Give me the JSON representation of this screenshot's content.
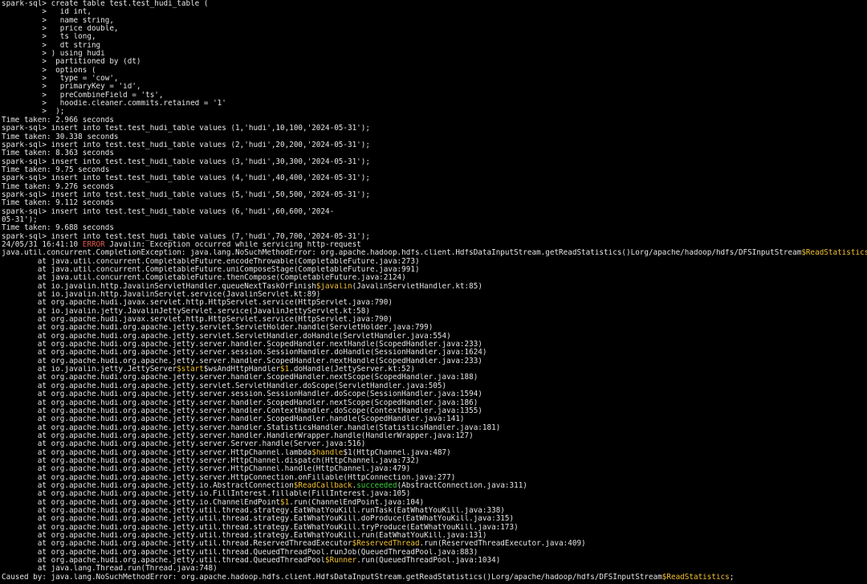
{
  "colors": {
    "background": "#000000",
    "text": "#e6e6e6",
    "highlight_yellow": "#f2c230",
    "highlight_red": "#e05a4e",
    "highlight_green": "#3fcf3f"
  },
  "terminal": {
    "lines": [
      [
        {
          "t": "spark-sql> create table test.test_hudi_table ("
        }
      ],
      [
        {
          "t": "         >   id int,"
        }
      ],
      [
        {
          "t": "         >   name string,"
        }
      ],
      [
        {
          "t": "         >   price double,"
        }
      ],
      [
        {
          "t": "         >   ts long,"
        }
      ],
      [
        {
          "t": "         >   dt string"
        }
      ],
      [
        {
          "t": "         > ) using hudi"
        }
      ],
      [
        {
          "t": "         >  partitioned by (dt)"
        }
      ],
      [
        {
          "t": "         >  options ("
        }
      ],
      [
        {
          "t": "         >   type = 'cow',"
        }
      ],
      [
        {
          "t": "         >   primaryKey = 'id',"
        }
      ],
      [
        {
          "t": "         >   preCombineField = 'ts',"
        }
      ],
      [
        {
          "t": "         >   hoodie.cleaner.commits.retained = '1'"
        }
      ],
      [
        {
          "t": "         >  );"
        }
      ],
      [
        {
          "t": "Time taken: 2.966 seconds"
        }
      ],
      [
        {
          "t": "spark-sql> insert into test.test_hudi_table values (1,'hudi',10,100,'2024-05-31');"
        }
      ],
      [
        {
          "t": "Time taken: 30.338 seconds"
        }
      ],
      [
        {
          "t": "spark-sql> insert into test.test_hudi_table values (2,'hudi',20,200,'2024-05-31');"
        }
      ],
      [
        {
          "t": "Time taken: 8.363 seconds"
        }
      ],
      [
        {
          "t": "spark-sql> insert into test.test_hudi_table values (3,'hudi',30,300,'2024-05-31');"
        }
      ],
      [
        {
          "t": "Time taken: 9.75 seconds"
        }
      ],
      [
        {
          "t": "spark-sql> insert into test.test_hudi_table values (4,'hudi',40,400,'2024-05-31');"
        }
      ],
      [
        {
          "t": "Time taken: 9.276 seconds"
        }
      ],
      [
        {
          "t": "spark-sql> insert into test.test_hudi_table values (5,'hudi',50,500,'2024-05-31');"
        }
      ],
      [
        {
          "t": "Time taken: 9.112 seconds"
        }
      ],
      [
        {
          "t": "spark-sql> insert into test.test_hudi_table values (6,'hudi',60,600,'2024-"
        }
      ],
      [
        {
          "t": "05-31');"
        }
      ],
      [
        {
          "t": "Time taken: 9.688 seconds"
        }
      ],
      [
        {
          "t": "spark-sql> insert into test.test_hudi_table values (7,'hudi',70,700,'2024-05-31');"
        }
      ],
      [
        {
          "t": "24/05/31 16:41:10 "
        },
        {
          "t": "ERROR",
          "c": "red"
        },
        {
          "t": " Javalin: Exception occurred while servicing http-request"
        }
      ],
      [
        {
          "t": "java.util.concurrent.CompletionException: java.lang.NoSuchMethodError: org.apache.hadoop.hdfs.client.HdfsDataInputStream.getReadStatistics()Lorg/apache/hadoop/hdfs/DFSInputStream"
        },
        {
          "t": "$ReadStatistics",
          "c": "yellow"
        },
        {
          "t": ";"
        }
      ],
      [
        {
          "t": "        at java.util.concurrent.CompletableFuture.encodeThrowable(CompletableFuture.java:273)"
        }
      ],
      [
        {
          "t": "        at java.util.concurrent.CompletableFuture.uniComposeStage(CompletableFuture.java:991)"
        }
      ],
      [
        {
          "t": "        at java.util.concurrent.CompletableFuture.thenCompose(CompletableFuture.java:2124)"
        }
      ],
      [
        {
          "t": "        at io.javalin.http.JavalinServletHandler.queueNextTaskOrFinish"
        },
        {
          "t": "$javalin",
          "c": "yellow"
        },
        {
          "t": "(JavalinServletHandler.kt:85)"
        }
      ],
      [
        {
          "t": "        at io.javalin.http.JavalinServlet.service(JavalinServlet.kt:89)"
        }
      ],
      [
        {
          "t": "        at org.apache.hudi.javax.servlet.http.HttpServlet.service(HttpServlet.java:790)"
        }
      ],
      [
        {
          "t": "        at io.javalin.jetty.JavalinJettyServlet.service(JavalinJettyServlet.kt:58)"
        }
      ],
      [
        {
          "t": "        at org.apache.hudi.javax.servlet.http.HttpServlet.service(HttpServlet.java:790)"
        }
      ],
      [
        {
          "t": "        at org.apache.hudi.org.apache.jetty.servlet.ServletHolder.handle(ServletHolder.java:799)"
        }
      ],
      [
        {
          "t": "        at org.apache.hudi.org.apache.jetty.servlet.ServletHandler.doHandle(ServletHandler.java:554)"
        }
      ],
      [
        {
          "t": "        at org.apache.hudi.org.apache.jetty.server.handler.ScopedHandler.nextHandle(ScopedHandler.java:233)"
        }
      ],
      [
        {
          "t": "        at org.apache.hudi.org.apache.jetty.server.session.SessionHandler.doHandle(SessionHandler.java:1624)"
        }
      ],
      [
        {
          "t": "        at org.apache.hudi.org.apache.jetty.server.handler.ScopedHandler.nextHandle(ScopedHandler.java:233)"
        }
      ],
      [
        {
          "t": "        at io.javalin.jetty.JettyServer"
        },
        {
          "t": "$start",
          "c": "yellow"
        },
        {
          "t": "$wsAndHttpHandler"
        },
        {
          "t": "$1",
          "c": "yellow"
        },
        {
          "t": ".doHandle(JettyServer.kt:52)"
        }
      ],
      [
        {
          "t": "        at org.apache.hudi.org.apache.jetty.server.handler.ScopedHandler.nextScope(ScopedHandler.java:188)"
        }
      ],
      [
        {
          "t": "        at org.apache.hudi.org.apache.jetty.servlet.ServletHandler.doScope(ServletHandler.java:505)"
        }
      ],
      [
        {
          "t": "        at org.apache.hudi.org.apache.jetty.server.session.SessionHandler.doScope(SessionHandler.java:1594)"
        }
      ],
      [
        {
          "t": "        at org.apache.hudi.org.apache.jetty.server.handler.ScopedHandler.nextScope(ScopedHandler.java:186)"
        }
      ],
      [
        {
          "t": "        at org.apache.hudi.org.apache.jetty.server.handler.ContextHandler.doScope(ContextHandler.java:1355)"
        }
      ],
      [
        {
          "t": "        at org.apache.hudi.org.apache.jetty.server.handler.ScopedHandler.handle(ScopedHandler.java:141)"
        }
      ],
      [
        {
          "t": "        at org.apache.hudi.org.apache.jetty.server.handler.StatisticsHandler.handle(StatisticsHandler.java:181)"
        }
      ],
      [
        {
          "t": "        at org.apache.hudi.org.apache.jetty.server.handler.HandlerWrapper.handle(HandlerWrapper.java:127)"
        }
      ],
      [
        {
          "t": "        at org.apache.hudi.org.apache.jetty.server.Server.handle(Server.java:516)"
        }
      ],
      [
        {
          "t": "        at org.apache.hudi.org.apache.jetty.server.HttpChannel.lambda"
        },
        {
          "t": "$handle",
          "c": "yellow"
        },
        {
          "t": "$1(HttpChannel.java:487)"
        }
      ],
      [
        {
          "t": "        at org.apache.hudi.org.apache.jetty.server.HttpChannel.dispatch(HttpChannel.java:732)"
        }
      ],
      [
        {
          "t": "        at org.apache.hudi.org.apache.jetty.server.HttpChannel.handle(HttpChannel.java:479)"
        }
      ],
      [
        {
          "t": "        at org.apache.hudi.org.apache.jetty.server.HttpConnection.onFillable(HttpConnection.java:277)"
        }
      ],
      [
        {
          "t": "        at org.apache.hudi.org.apache.jetty.io.AbstractConnection"
        },
        {
          "t": "$ReadCallback",
          "c": "yellow"
        },
        {
          "t": "."
        },
        {
          "t": "succeeded",
          "c": "green"
        },
        {
          "t": "(AbstractConnection.java:311)"
        }
      ],
      [
        {
          "t": "        at org.apache.hudi.org.apache.jetty.io.FillInterest.fillable(FillInterest.java:105)"
        }
      ],
      [
        {
          "t": "        at org.apache.hudi.org.apache.jetty.io.ChannelEndPoint"
        },
        {
          "t": "$1",
          "c": "yellow"
        },
        {
          "t": ".run(ChannelEndPoint.java:104)"
        }
      ],
      [
        {
          "t": "        at org.apache.hudi.org.apache.jetty.util.thread.strategy.EatWhatYouKill.runTask(EatWhatYouKill.java:338)"
        }
      ],
      [
        {
          "t": "        at org.apache.hudi.org.apache.jetty.util.thread.strategy.EatWhatYouKill.doProduce(EatWhatYouKill.java:315)"
        }
      ],
      [
        {
          "t": "        at org.apache.hudi.org.apache.jetty.util.thread.strategy.EatWhatYouKill.tryProduce(EatWhatYouKill.java:173)"
        }
      ],
      [
        {
          "t": "        at org.apache.hudi.org.apache.jetty.util.thread.strategy.EatWhatYouKill.run(EatWhatYouKill.java:131)"
        }
      ],
      [
        {
          "t": "        at org.apache.hudi.org.apache.jetty.util.thread.ReservedThreadExecutor"
        },
        {
          "t": "$ReservedThread",
          "c": "yellow"
        },
        {
          "t": ".run(ReservedThreadExecutor.java:409)"
        }
      ],
      [
        {
          "t": "        at org.apache.hudi.org.apache.jetty.util.thread.QueuedThreadPool.runJob(QueuedThreadPool.java:883)"
        }
      ],
      [
        {
          "t": "        at org.apache.hudi.org.apache.jetty.util.thread.QueuedThreadPool"
        },
        {
          "t": "$Runner",
          "c": "yellow"
        },
        {
          "t": ".run(QueuedThreadPool.java:1034)"
        }
      ],
      [
        {
          "t": "        at java.lang.Thread.run(Thread.java:748)"
        }
      ],
      [
        {
          "t": "Caused by: java.lang.NoSuchMethodError: org.apache.hadoop.hdfs.client.HdfsDataInputStream.getReadStatistics()Lorg/apache/hadoop/hdfs/DFSInputStream"
        },
        {
          "t": "$ReadStatistics",
          "c": "yellow"
        },
        {
          "t": ";"
        }
      ]
    ]
  }
}
